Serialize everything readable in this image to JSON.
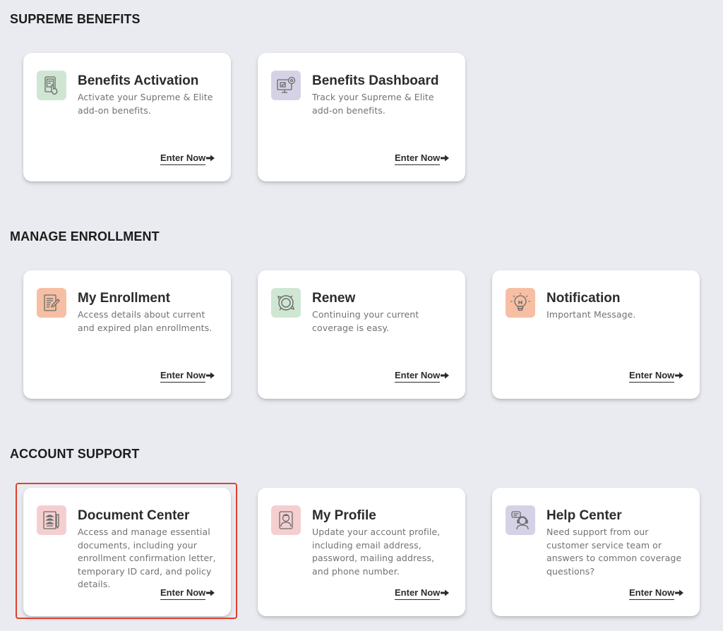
{
  "enter_label": "Enter Now",
  "sections": [
    {
      "title": "SUPREME BENEFITS",
      "cards": [
        {
          "title": "Benefits Activation",
          "desc": "Activate your Supreme & Elite add-on benefits.",
          "icon": "tablet-touch-icon",
          "icon_bg": "#cfe6d3"
        },
        {
          "title": "Benefits Dashboard",
          "desc": "Track your Supreme & Elite add-on benefits.",
          "icon": "monitor-dashboard-icon",
          "icon_bg": "#d6d2e6"
        }
      ]
    },
    {
      "title": "MANAGE ENROLLMENT",
      "cards": [
        {
          "title": "My Enrollment",
          "desc": "Access details about current and expired plan enrollments.",
          "icon": "document-edit-icon",
          "icon_bg": "#f6bfa3"
        },
        {
          "title": "Renew",
          "desc": "Continuing your current coverage is easy.",
          "icon": "renew-cycle-icon",
          "icon_bg": "#cfe6d3"
        },
        {
          "title": "Notification",
          "desc": "Important Message.",
          "icon": "lightbulb-icon",
          "icon_bg": "#f6bfa3"
        }
      ]
    },
    {
      "title": "ACCOUNT SUPPORT",
      "cards": [
        {
          "title": "Document Center",
          "desc": "Access and manage essential documents, including your enrollment confirmation letter, temporary ID card, and policy details.",
          "icon": "document-stack-icon",
          "icon_bg": "#f5cfd0"
        },
        {
          "title": "My Profile",
          "desc": "Update your account profile, including email address, password, mailing address, and phone number.",
          "icon": "profile-person-icon",
          "icon_bg": "#f5cfd0"
        },
        {
          "title": "Help Center",
          "desc": "Need support from our customer service team or answers to common coverage questions?",
          "icon": "support-headset-icon",
          "icon_bg": "#d6d2e6"
        }
      ]
    }
  ],
  "highlighted_card": "Document Center",
  "highlight_color": "#e0402e"
}
